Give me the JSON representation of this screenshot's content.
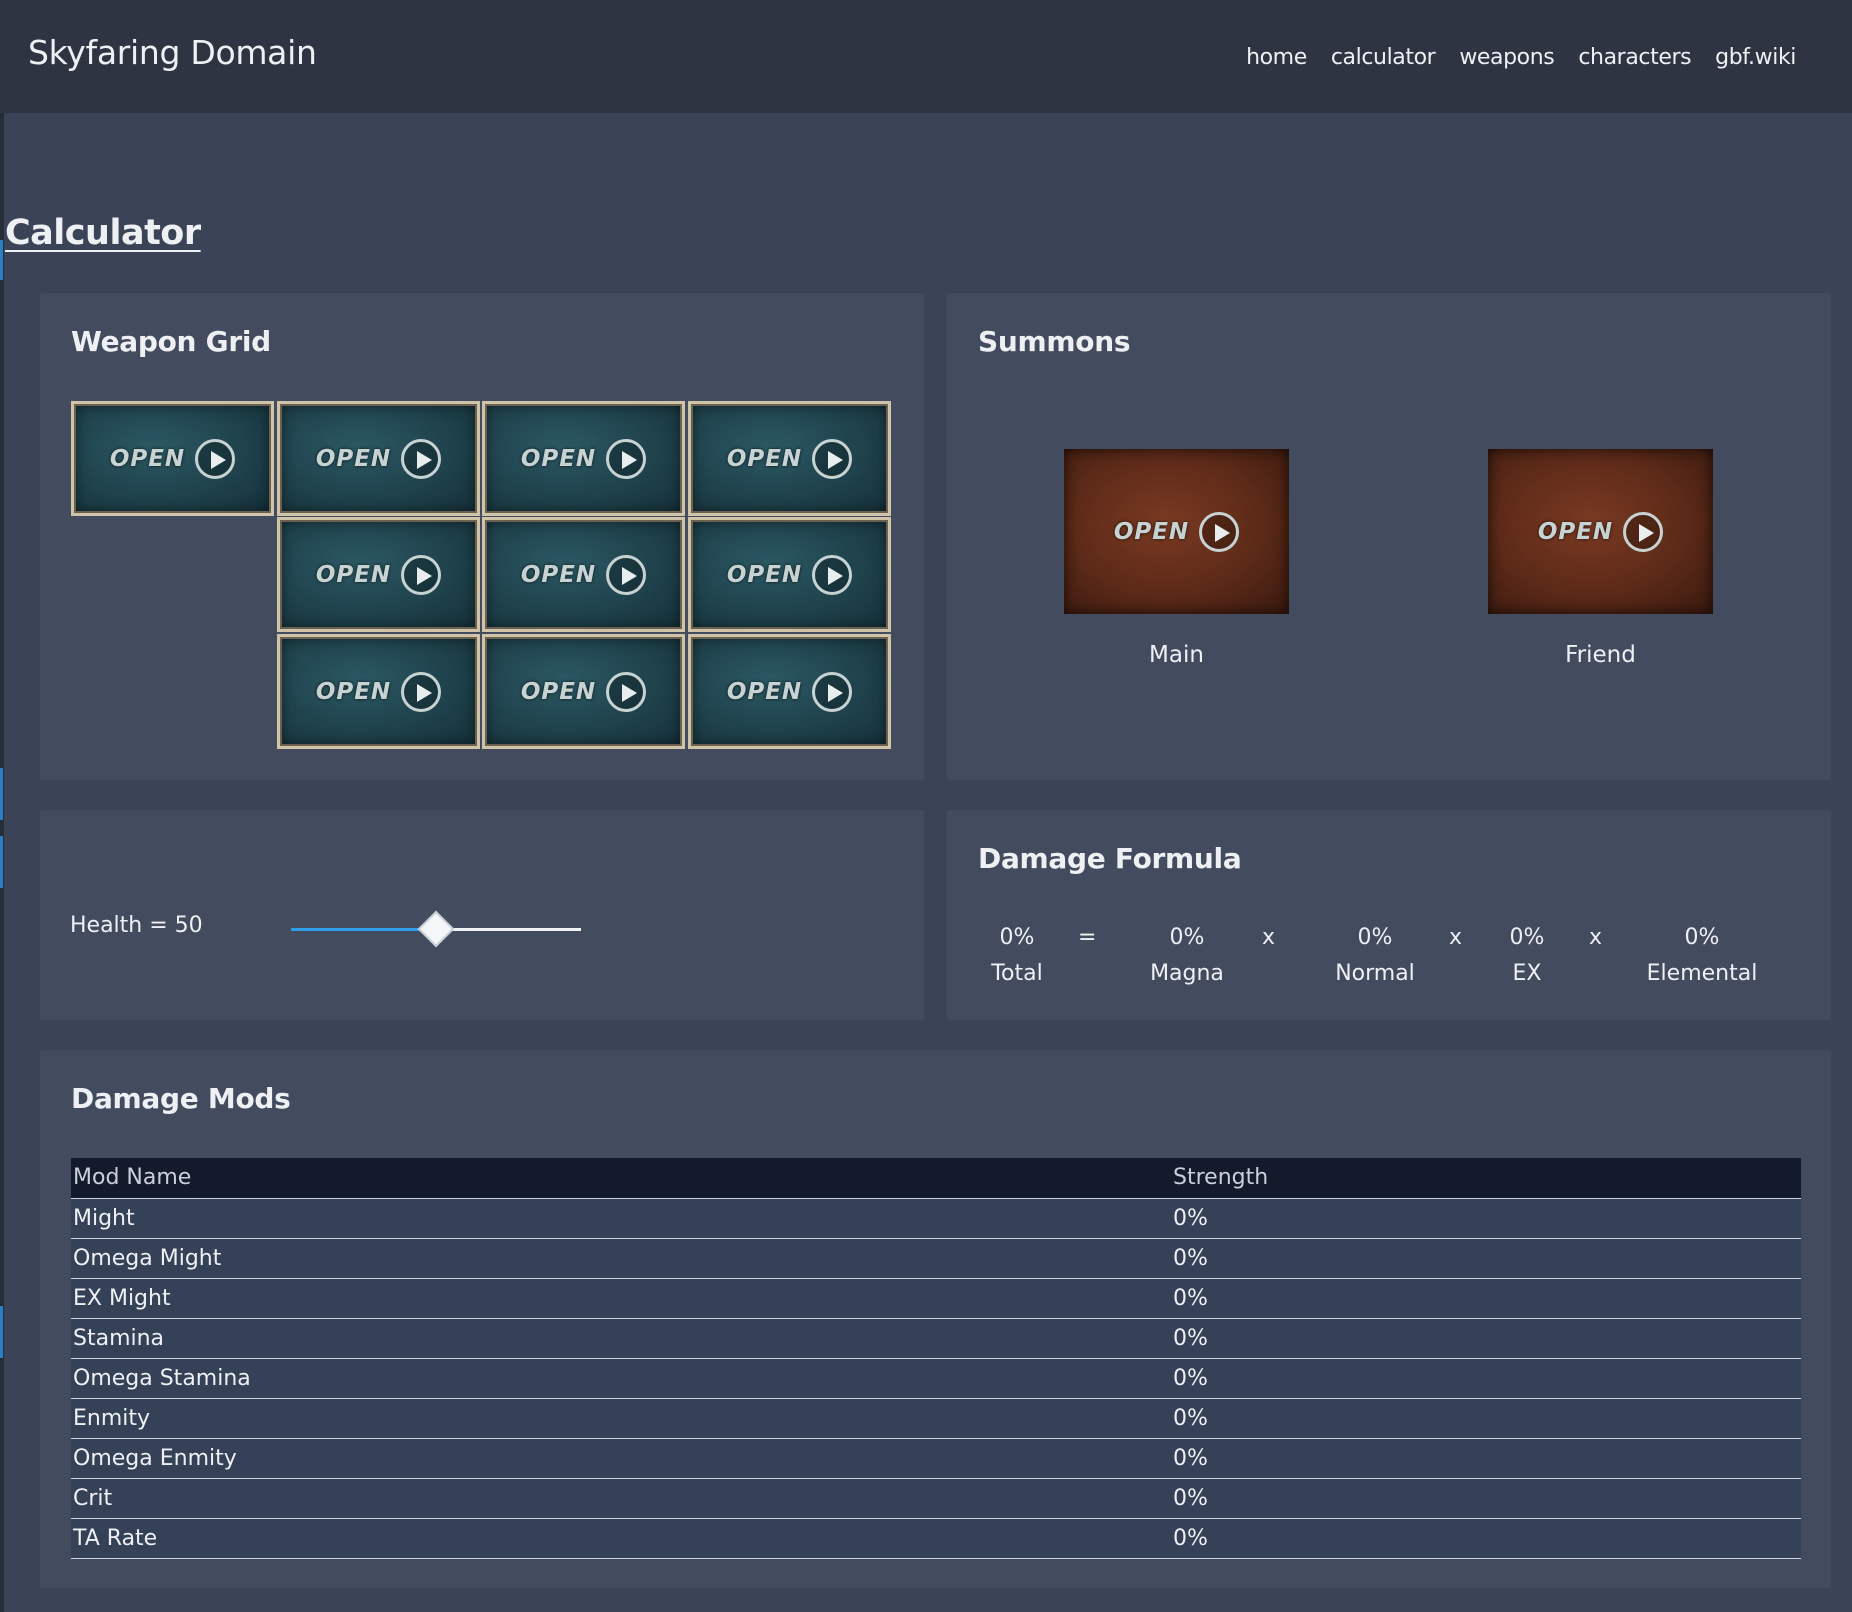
{
  "header": {
    "brand": "Skyfaring Domain",
    "nav": [
      "home",
      "calculator",
      "weapons",
      "characters",
      "gbf.wiki"
    ]
  },
  "page": {
    "title": "Calculator"
  },
  "weapon_grid": {
    "title": "Weapon Grid",
    "slot_label": "OPEN",
    "slot_count": 10
  },
  "summons": {
    "title": "Summons",
    "slot_label": "OPEN",
    "main_label": "Main",
    "friend_label": "Friend"
  },
  "health": {
    "label": "Health = 50",
    "value": 50,
    "max": 100
  },
  "damage_formula": {
    "title": "Damage Formula",
    "terms": [
      {
        "value": "0%",
        "label": "Total"
      },
      {
        "value": "0%",
        "label": "Magna"
      },
      {
        "value": "0%",
        "label": "Normal"
      },
      {
        "value": "0%",
        "label": "EX"
      },
      {
        "value": "0%",
        "label": "Elemental"
      }
    ],
    "operators": [
      "=",
      "x",
      "x",
      "x"
    ]
  },
  "damage_mods": {
    "title": "Damage Mods",
    "columns": [
      "Mod Name",
      "Strength"
    ],
    "rows": [
      [
        "Might",
        "0%"
      ],
      [
        "Omega Might",
        "0%"
      ],
      [
        "EX Might",
        "0%"
      ],
      [
        "Stamina",
        "0%"
      ],
      [
        "Omega Stamina",
        "0%"
      ],
      [
        "Enmity",
        "0%"
      ],
      [
        "Omega Enmity",
        "0%"
      ],
      [
        "Crit",
        "0%"
      ],
      [
        "TA Rate",
        "0%"
      ]
    ]
  },
  "colors": {
    "background": "#3b4457",
    "header": "#2e3441",
    "card": "#434c5f",
    "accent": "#2f9ee8",
    "table_header": "#121a2b",
    "table_row": "#344156"
  }
}
